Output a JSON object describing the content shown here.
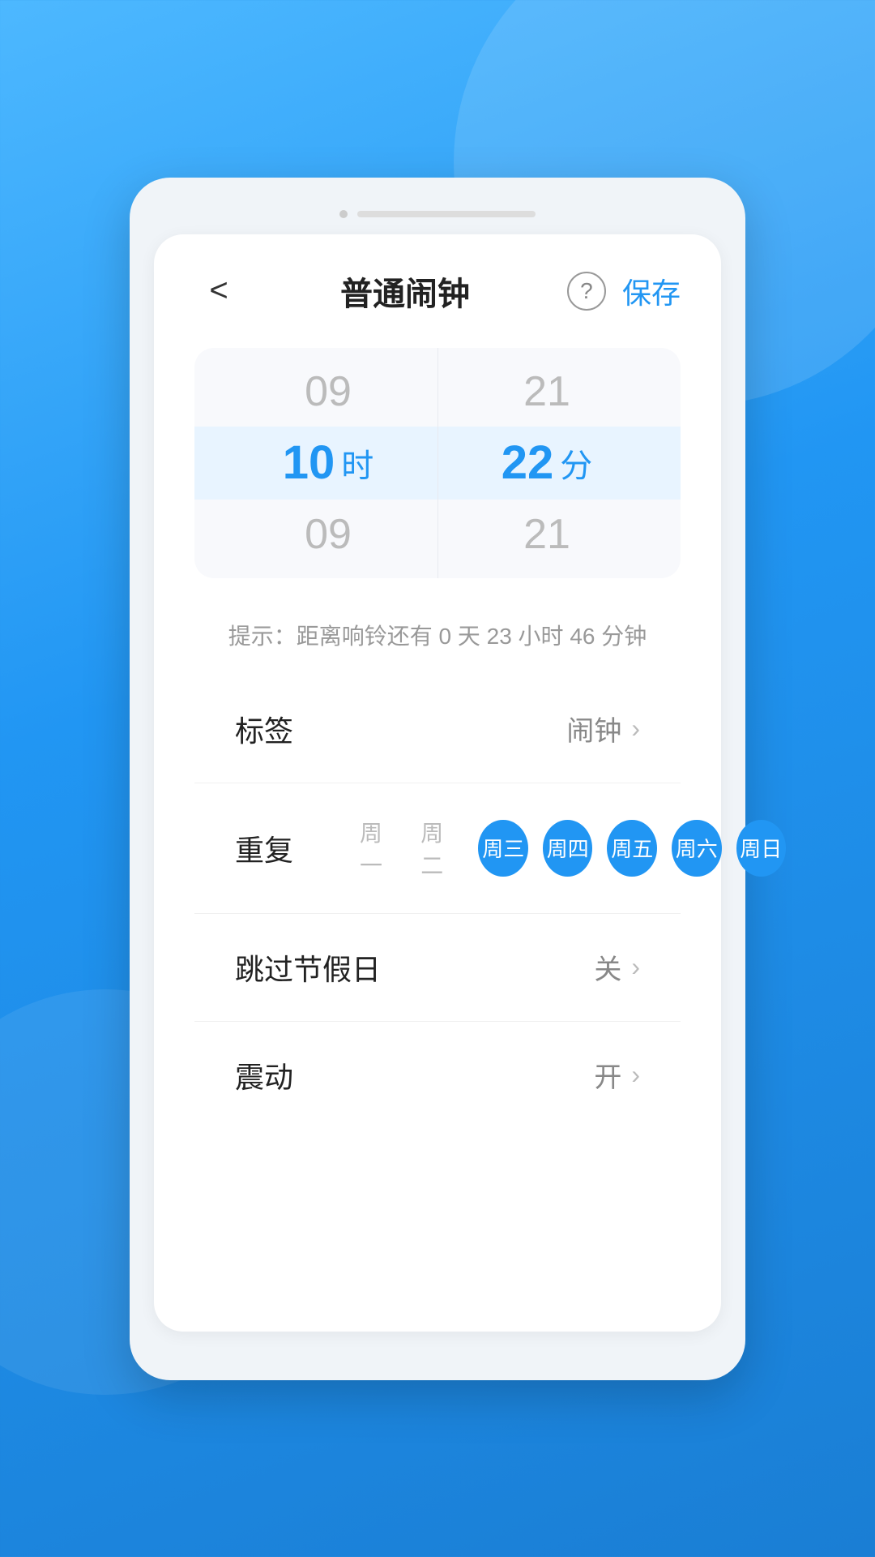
{
  "background": {
    "gradient_start": "#4db8ff",
    "gradient_end": "#1a7ed4"
  },
  "status_bar": {
    "dot_color": "#ccc",
    "line_color": "#ddd"
  },
  "header": {
    "back_label": "<",
    "title": "普通闹钟",
    "help_label": "?",
    "save_label": "保存"
  },
  "time_picker": {
    "hour_above": "09",
    "hour_selected": "10",
    "hour_label": "时",
    "hour_below": "09",
    "minute_above": "21",
    "minute_selected": "22",
    "minute_label": "分",
    "minute_below": "21"
  },
  "hint": {
    "text": "提示：距离响铃还有 0 天 23 小时 46 分钟"
  },
  "settings": {
    "tag": {
      "label": "标签",
      "value": "闹钟",
      "arrow": "›"
    },
    "repeat": {
      "label": "重复",
      "days": [
        {
          "label": "周一",
          "active": false
        },
        {
          "label": "周二",
          "active": false
        },
        {
          "label": "周三",
          "active": true
        },
        {
          "label": "周四",
          "active": true
        },
        {
          "label": "周五",
          "active": true
        },
        {
          "label": "周六",
          "active": true
        },
        {
          "label": "周日",
          "active": true
        }
      ]
    },
    "holiday": {
      "label": "跳过节假日",
      "value": "关",
      "arrow": "›"
    },
    "vibration": {
      "label": "震动",
      "value": "开",
      "arrow": "›"
    }
  }
}
